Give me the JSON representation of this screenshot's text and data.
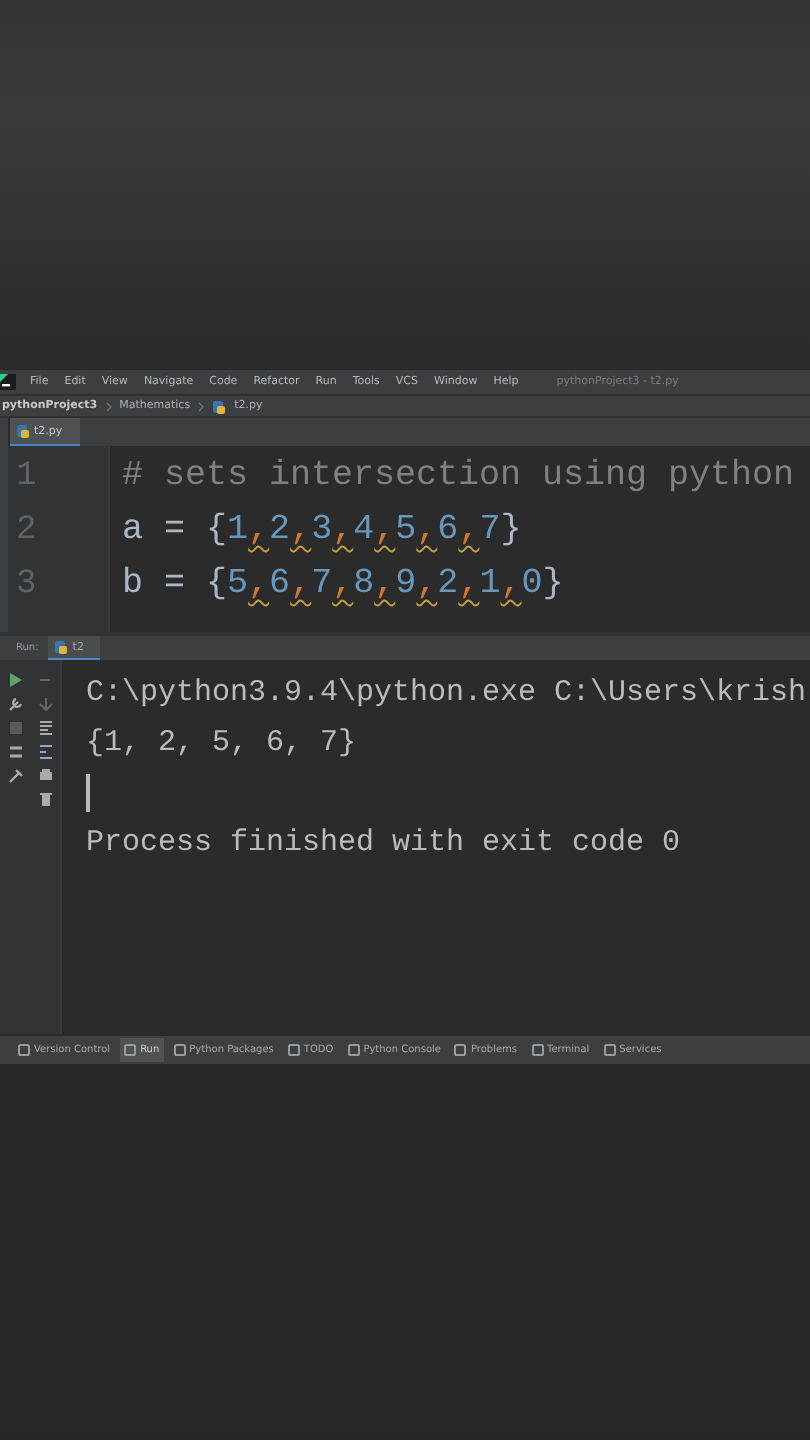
{
  "menu": [
    "File",
    "Edit",
    "View",
    "Navigate",
    "Code",
    "Refactor",
    "Run",
    "Tools",
    "VCS",
    "Window",
    "Help"
  ],
  "window_title": "pythonProject3 - t2.py",
  "breadcrumbs": [
    "pythonProject3",
    "Mathematics",
    "t2.py"
  ],
  "editor_tabs": [
    {
      "label": "t2.py",
      "selected": true
    }
  ],
  "editor": {
    "lines": [
      {
        "number": "1",
        "tokens": [
          {
            "kind": "comment",
            "text": "# sets intersection using python"
          }
        ]
      },
      {
        "number": "2",
        "tokens": [
          {
            "kind": "plain",
            "text": "a = {"
          },
          {
            "kind": "number",
            "text": "1"
          },
          {
            "kind": "comma",
            "text": ","
          },
          {
            "kind": "number",
            "text": "2"
          },
          {
            "kind": "comma",
            "text": ","
          },
          {
            "kind": "number",
            "text": "3"
          },
          {
            "kind": "comma",
            "text": ","
          },
          {
            "kind": "number",
            "text": "4"
          },
          {
            "kind": "comma",
            "text": ","
          },
          {
            "kind": "number",
            "text": "5"
          },
          {
            "kind": "comma",
            "text": ","
          },
          {
            "kind": "number",
            "text": "6"
          },
          {
            "kind": "comma",
            "text": ","
          },
          {
            "kind": "number",
            "text": "7"
          },
          {
            "kind": "plain",
            "text": "}"
          }
        ]
      },
      {
        "number": "3",
        "tokens": [
          {
            "kind": "plain",
            "text": "b = {"
          },
          {
            "kind": "number",
            "text": "5"
          },
          {
            "kind": "comma",
            "text": ","
          },
          {
            "kind": "number",
            "text": "6"
          },
          {
            "kind": "comma",
            "text": ","
          },
          {
            "kind": "number",
            "text": "7"
          },
          {
            "kind": "comma",
            "text": ","
          },
          {
            "kind": "number",
            "text": "8"
          },
          {
            "kind": "comma",
            "text": ","
          },
          {
            "kind": "number",
            "text": "9"
          },
          {
            "kind": "comma",
            "text": ","
          },
          {
            "kind": "number",
            "text": "2"
          },
          {
            "kind": "comma",
            "text": ","
          },
          {
            "kind": "number",
            "text": "1"
          },
          {
            "kind": "comma",
            "text": ","
          },
          {
            "kind": "number",
            "text": "0"
          },
          {
            "kind": "plain",
            "text": "}"
          }
        ]
      }
    ]
  },
  "run_panel": {
    "label": "Run:",
    "tabs": [
      {
        "label": "t2",
        "selected": true
      }
    ],
    "console": [
      {
        "kind": "text",
        "text": "C:\\python3.9.4\\python.exe C:\\Users\\krish"
      },
      {
        "kind": "text",
        "text": "{1, 2, 5, 6, 7}"
      },
      {
        "kind": "cursor"
      },
      {
        "kind": "text",
        "text": "Process finished with exit code 0"
      }
    ]
  },
  "tool_windows": [
    {
      "label": "Version Control",
      "selected": false
    },
    {
      "label": "Run",
      "selected": true
    },
    {
      "label": "Python Packages",
      "selected": false
    },
    {
      "label": "TODO",
      "selected": false
    },
    {
      "label": "Python Console",
      "selected": false
    },
    {
      "label": "Problems",
      "selected": false
    },
    {
      "label": "Terminal",
      "selected": false
    },
    {
      "label": "Services",
      "selected": false
    }
  ]
}
